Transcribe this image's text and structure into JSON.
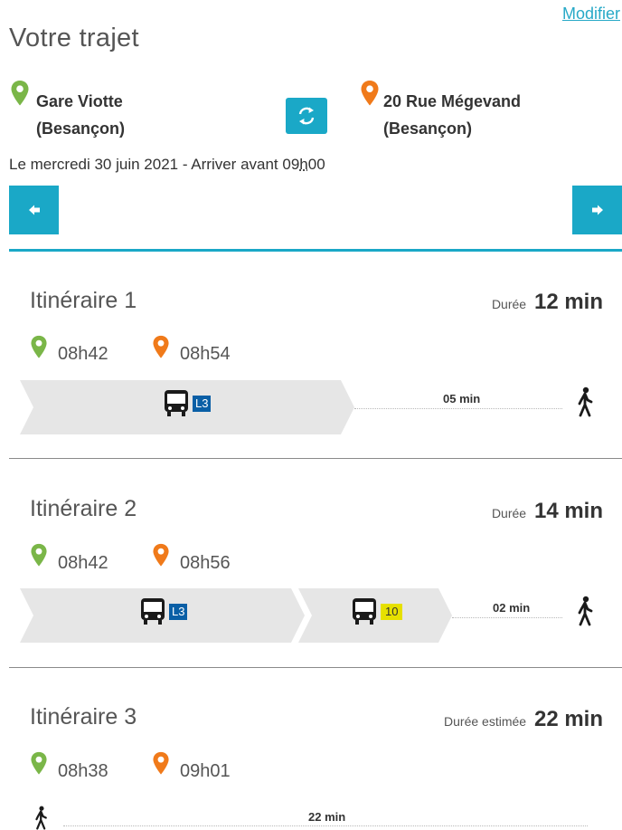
{
  "header": {
    "modify_link": "Modifier",
    "title": "Votre trajet"
  },
  "route": {
    "from": {
      "name": "Gare Viotte",
      "city": "(Besançon)"
    },
    "to": {
      "name": "20 Rue Mégevand",
      "city": "(Besançon)"
    },
    "date_text": "Le mercredi 30 juin 2021 - Arriver avant 09",
    "date_hour_sep": "h",
    "date_minutes": "00"
  },
  "colors": {
    "accent": "#1aa8c7",
    "origin_pin": "#7ab648",
    "destination_pin": "#f07a1a",
    "line_l3_bg": "#0a5fa6",
    "line_10_bg": "#e6e000"
  },
  "itineraries": [
    {
      "title": "Itinéraire 1",
      "duration_label": "Durée",
      "duration_value": "12 min",
      "depart": "08h42",
      "arrive": "08h54",
      "segments": [
        {
          "type": "bus",
          "line": "L3"
        },
        {
          "type": "walk",
          "minutes": "05 min"
        }
      ]
    },
    {
      "title": "Itinéraire 2",
      "duration_label": "Durée",
      "duration_value": "14 min",
      "depart": "08h42",
      "arrive": "08h56",
      "segments": [
        {
          "type": "bus",
          "line": "L3"
        },
        {
          "type": "bus",
          "line": "10"
        },
        {
          "type": "walk",
          "minutes": "02 min"
        }
      ]
    },
    {
      "title": "Itinéraire 3",
      "duration_label": "Durée estimée",
      "duration_value": "22 min",
      "depart": "08h38",
      "arrive": "09h01",
      "segments": [
        {
          "type": "walk",
          "minutes": "22 min"
        }
      ]
    }
  ],
  "icons": {
    "origin": "location-pin-icon",
    "destination": "location-pin-icon",
    "swap": "swap-arrows-icon",
    "prev": "arrow-left-icon",
    "next": "arrow-right-icon",
    "bus": "bus-icon",
    "walk": "pedestrian-icon"
  }
}
